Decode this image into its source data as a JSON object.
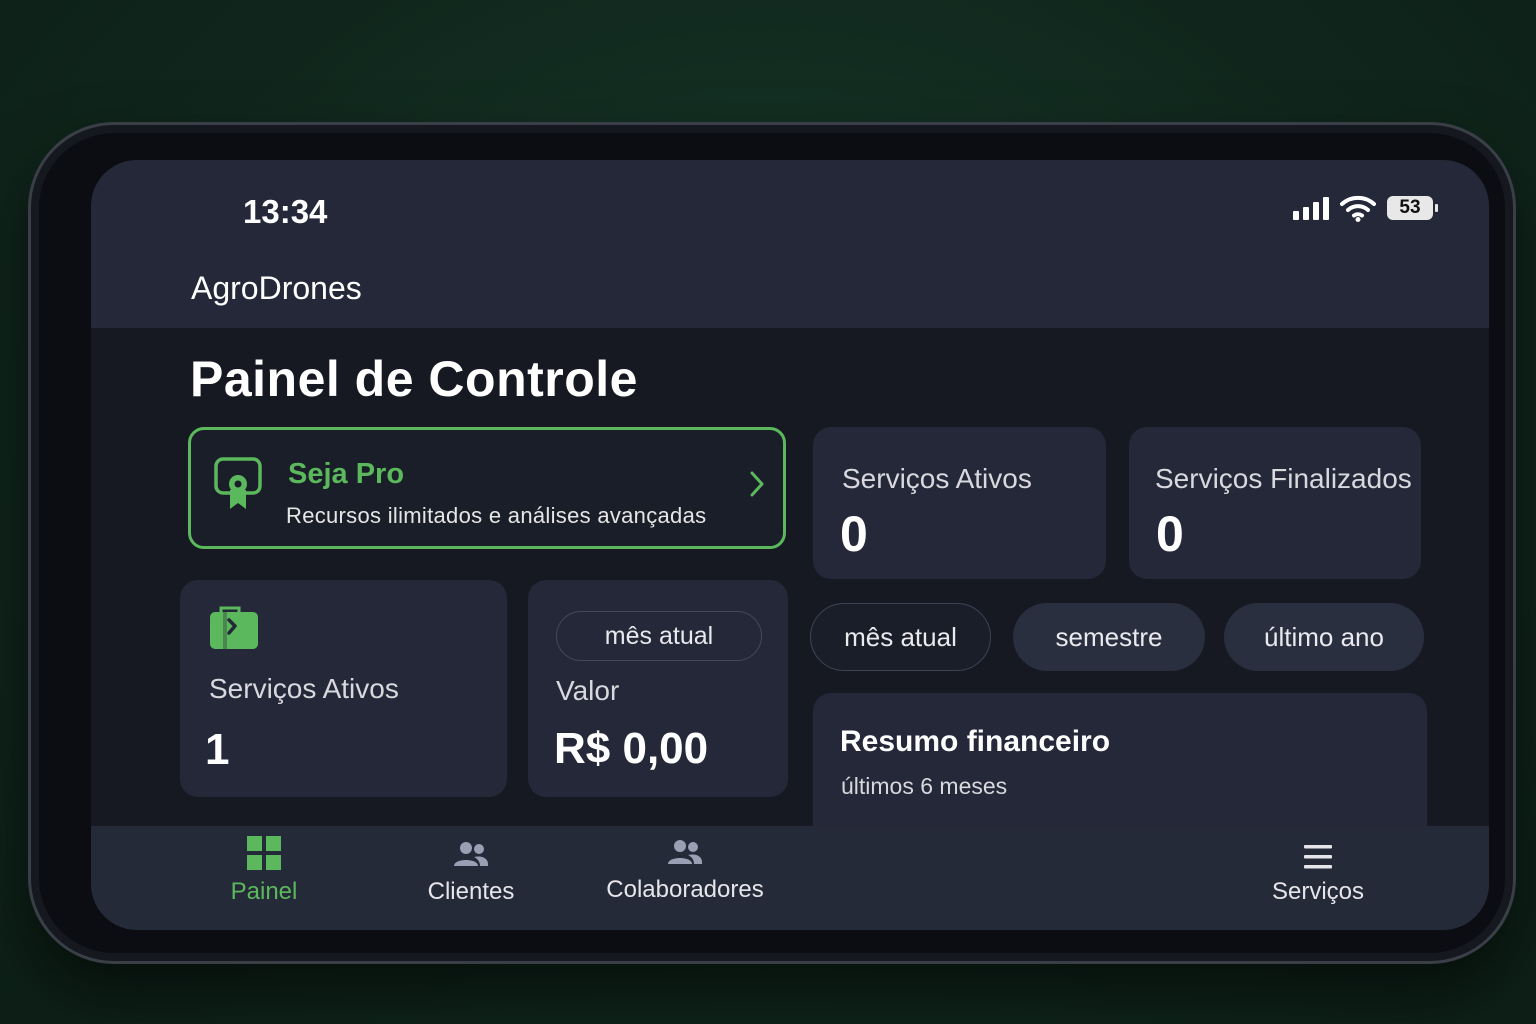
{
  "status": {
    "time": "13:34",
    "battery": "53"
  },
  "app": {
    "title": "AgroDrones"
  },
  "page": {
    "title": "Painel de Controle"
  },
  "promo": {
    "title": "Seja Pro",
    "subtitle": "Recursos ilimitados e análises avançadas"
  },
  "stats": {
    "ativos": {
      "label": "Serviços Ativos",
      "value": "0"
    },
    "finalizados": {
      "label": "Serviços Finalizados",
      "value": "0"
    },
    "ativos_card": {
      "label": "Serviços Ativos",
      "value": "1",
      "icon": "wallet-icon"
    },
    "valor": {
      "period": "mês atual",
      "label": "Valor",
      "value": "R$ 0,00"
    }
  },
  "period_filters": [
    "mês atual",
    "semestre",
    "último ano"
  ],
  "finance": {
    "title": "Resumo financeiro",
    "subtitle": "últimos 6 meses"
  },
  "nav": [
    {
      "label": "Painel",
      "icon": "grid-icon",
      "active": true
    },
    {
      "label": "Clientes",
      "icon": "people-icon"
    },
    {
      "label": "Colaboradores",
      "icon": "people-icon"
    },
    {
      "label": "Serviços",
      "icon": "menu-icon"
    }
  ],
  "colors": {
    "accent": "#5cb85c",
    "card": "#242838",
    "background": "#161922"
  }
}
